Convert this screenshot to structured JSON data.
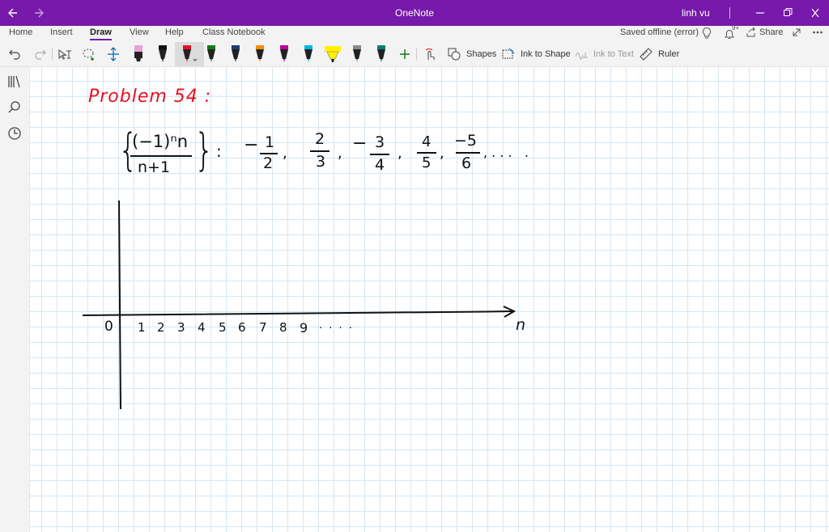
{
  "window": {
    "title": "OneNote",
    "user": "linh vu"
  },
  "tabs": [
    {
      "label": "Home"
    },
    {
      "label": "Insert"
    },
    {
      "label": "Draw"
    },
    {
      "label": "View"
    },
    {
      "label": "Help"
    },
    {
      "label": "Class Notebook"
    }
  ],
  "status": {
    "saved": "Saved offline (error)",
    "notif_count": "9+",
    "share_label": "Share"
  },
  "toolbar": {
    "shapes_label": "Shapes",
    "ink_to_shape_label": "Ink to Shape",
    "ink_to_text_label": "Ink to Text",
    "ruler_label": "Ruler"
  },
  "pens": [
    {
      "icon": "highlighter-pink-icon",
      "color": "#e7a1d6"
    },
    {
      "icon": "pen-black-icon",
      "color": "#111111"
    },
    {
      "icon": "pen-red-icon",
      "color": "#e81123"
    },
    {
      "icon": "pen-green-icon",
      "color": "#107c10"
    },
    {
      "icon": "pen-navy-icon",
      "color": "#1f3a75"
    },
    {
      "icon": "pen-orange-icon",
      "color": "#ff8c00"
    },
    {
      "icon": "pen-magenta-icon",
      "color": "#b4009e"
    },
    {
      "icon": "pen-cyan-icon",
      "color": "#00b7e8"
    },
    {
      "icon": "highlighter-yellow-icon",
      "color": "#fff100"
    },
    {
      "icon": "pen-gray-icon",
      "color": "#8a8a8a"
    },
    {
      "icon": "pen-teal-icon",
      "color": "#008272"
    }
  ],
  "note": {
    "title": "Problem 54 :",
    "seq_num": "(−1)ⁿn",
    "seq_den": "n+1",
    "colon": ":",
    "terms": [
      {
        "sign": "−",
        "num": "1",
        "den": "2"
      },
      {
        "sign": "",
        "num": "2",
        "den": "3"
      },
      {
        "sign": "−",
        "num": "3",
        "den": "4"
      },
      {
        "sign": "",
        "num": "4",
        "den": "5"
      },
      {
        "sign": "",
        "num": "−5",
        "den": "6"
      }
    ],
    "ellipsis": ", . . .   .",
    "origin": "0",
    "ticks": [
      "1",
      "2",
      "3",
      "4",
      "5",
      "6",
      "7",
      "8",
      "9"
    ],
    "tick_ellipsis": ". . . .",
    "axis_label": "n"
  },
  "colors": {
    "accent": "#7719aa",
    "ink_red": "#e81123",
    "grid": "#d6e6f2"
  }
}
